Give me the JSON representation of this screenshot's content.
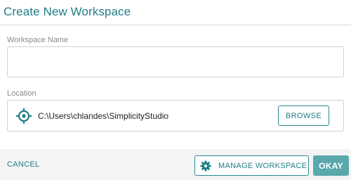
{
  "dialog": {
    "title": "Create New Workspace"
  },
  "workspace_name": {
    "label": "Workspace Name",
    "value": ""
  },
  "location": {
    "label": "Location",
    "path": "C:\\Users\\chlandes\\SimplicityStudio",
    "icon": "target-icon",
    "browse_label": "BROWSE"
  },
  "footer": {
    "cancel_label": "CANCEL",
    "manage_label": "MANAGE WORKSPACE",
    "manage_icon": "gear-icon",
    "okay_label": "OKAY"
  },
  "colors": {
    "accent": "#1e7f86",
    "primary_button": "#59a8ac",
    "footer_bg": "#f4f4f4"
  }
}
